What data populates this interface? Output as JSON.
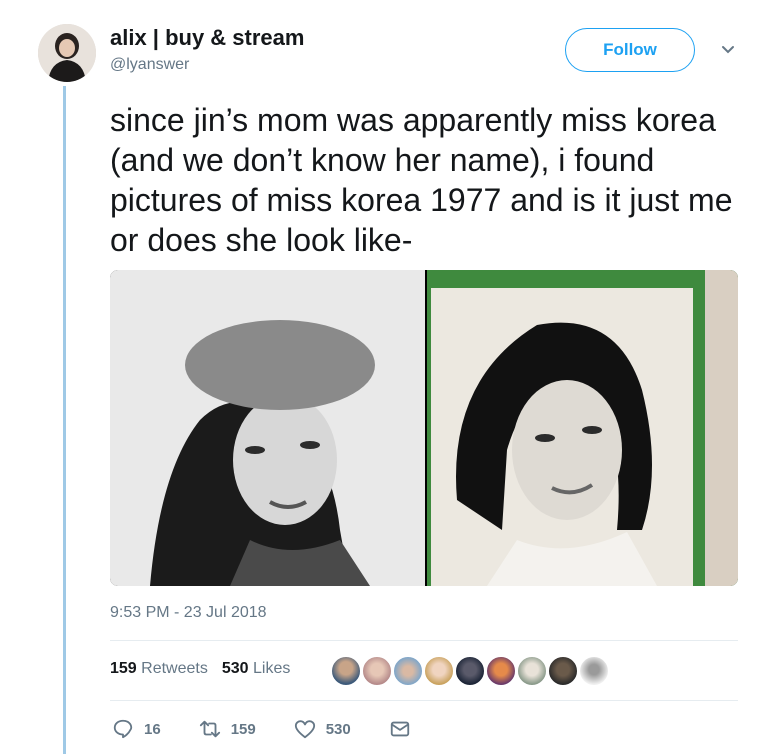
{
  "user": {
    "display_name": "alix | buy & stream",
    "handle": "@lyanswer"
  },
  "follow_label": "Follow",
  "tweet": {
    "text": "since jin’s mom was apparently miss korea (and we don’t know her name), i found pictures of miss korea 1977 and is it just me or does she look like-",
    "timestamp": "9:53 PM - 23 Jul 2018"
  },
  "stats": {
    "retweets_count": "159",
    "retweets_label": "Retweets",
    "likes_count": "530",
    "likes_label": "Likes"
  },
  "actions": {
    "reply_count": "16",
    "retweet_count": "159",
    "like_count": "530"
  },
  "colors": {
    "accent": "#1da1f2",
    "muted": "#657786",
    "thread_line": "#9fc9e6",
    "photo_background_green": "#3f8a3e"
  }
}
